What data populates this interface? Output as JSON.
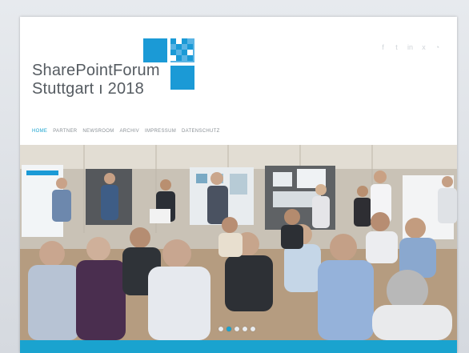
{
  "site": {
    "logo_line1": "SharePointForum",
    "logo_line2": "Stuttgart ı 2018"
  },
  "nav": {
    "items": [
      {
        "label": "Home",
        "active": true
      },
      {
        "label": "Partner",
        "active": false
      },
      {
        "label": "Newsroom",
        "active": false
      },
      {
        "label": "Archiv",
        "active": false
      },
      {
        "label": "Impressum",
        "active": false
      },
      {
        "label": "Datenschutz",
        "active": false
      }
    ]
  },
  "social_icons": [
    "facebook-icon",
    "twitter-icon",
    "linkedin-icon",
    "xing-icon",
    "rss-icon"
  ],
  "slider": {
    "slide_count": 5,
    "active_index": 1
  },
  "colors": {
    "accent": "#1aa3cf",
    "logo_blue": "#1b9ad6",
    "text": "#555b61"
  }
}
